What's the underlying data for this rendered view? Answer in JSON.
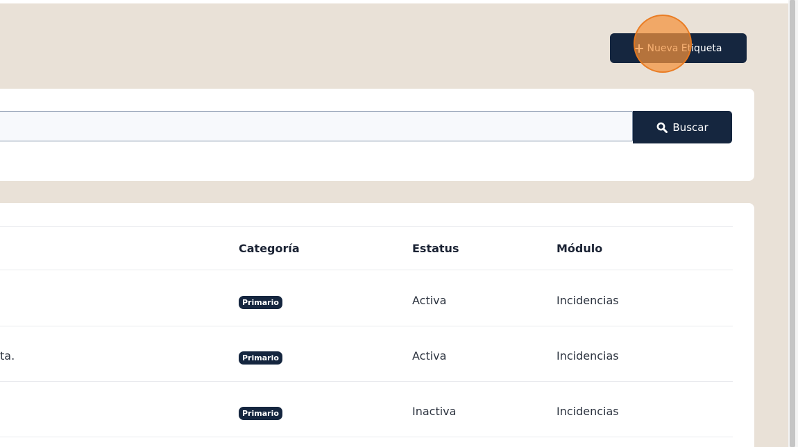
{
  "header": {
    "new_button_label": "Nueva Etiqueta"
  },
  "search": {
    "value": "",
    "placeholder": "",
    "button_label": "Buscar"
  },
  "table": {
    "columns": [
      "Categoría",
      "Estatus",
      "Módulo"
    ],
    "rows": [
      {
        "name": "",
        "category": "Primario",
        "status": "Activa",
        "module": "Incidencias"
      },
      {
        "name": "ta.",
        "category": "Primario",
        "status": "Activa",
        "module": "Incidencias"
      },
      {
        "name": "",
        "category": "Primario",
        "status": "Inactiva",
        "module": "Incidencias"
      }
    ]
  },
  "icons": {
    "new_button": "plus-icon",
    "search_button": "search-icon"
  },
  "colors": {
    "primary": "#15263f",
    "background": "#e9e1d7",
    "click_indicator": "#f4923c"
  }
}
